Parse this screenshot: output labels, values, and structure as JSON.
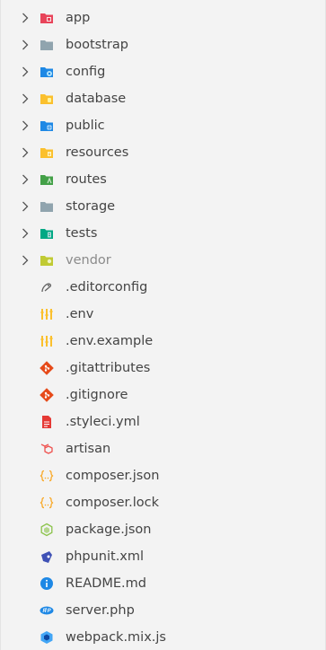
{
  "explorer": {
    "folders": [
      {
        "name": "app",
        "icon": "app-folder-icon",
        "color": "#e8445a"
      },
      {
        "name": "bootstrap",
        "icon": "folder-icon",
        "color": "#90a4ae"
      },
      {
        "name": "config",
        "icon": "config-folder-icon",
        "color": "#1e88e5"
      },
      {
        "name": "database",
        "icon": "database-folder-icon",
        "color": "#fbc02d"
      },
      {
        "name": "public",
        "icon": "public-folder-icon",
        "color": "#1e88e5"
      },
      {
        "name": "resources",
        "icon": "resources-folder-icon",
        "color": "#fbc02d"
      },
      {
        "name": "routes",
        "icon": "routes-folder-icon",
        "color": "#43a047"
      },
      {
        "name": "storage",
        "icon": "folder-icon",
        "color": "#90a4ae"
      },
      {
        "name": "tests",
        "icon": "tests-folder-icon",
        "color": "#00a884"
      },
      {
        "name": "vendor",
        "icon": "vendor-folder-icon",
        "color": "#c0ca33"
      }
    ],
    "files": [
      {
        "name": ".editorconfig",
        "icon": "editorconfig-icon"
      },
      {
        "name": ".env",
        "icon": "env-icon"
      },
      {
        "name": ".env.example",
        "icon": "env-icon"
      },
      {
        "name": ".gitattributes",
        "icon": "git-icon"
      },
      {
        "name": ".gitignore",
        "icon": "git-icon"
      },
      {
        "name": ".styleci.yml",
        "icon": "yaml-icon"
      },
      {
        "name": "artisan",
        "icon": "laravel-icon"
      },
      {
        "name": "composer.json",
        "icon": "json-icon"
      },
      {
        "name": "composer.lock",
        "icon": "json-icon"
      },
      {
        "name": "package.json",
        "icon": "nodejs-icon"
      },
      {
        "name": "phpunit.xml",
        "icon": "phpunit-icon"
      },
      {
        "name": "README.md",
        "icon": "info-icon"
      },
      {
        "name": "server.php",
        "icon": "php-icon"
      },
      {
        "name": "webpack.mix.js",
        "icon": "webpack-icon"
      }
    ]
  }
}
